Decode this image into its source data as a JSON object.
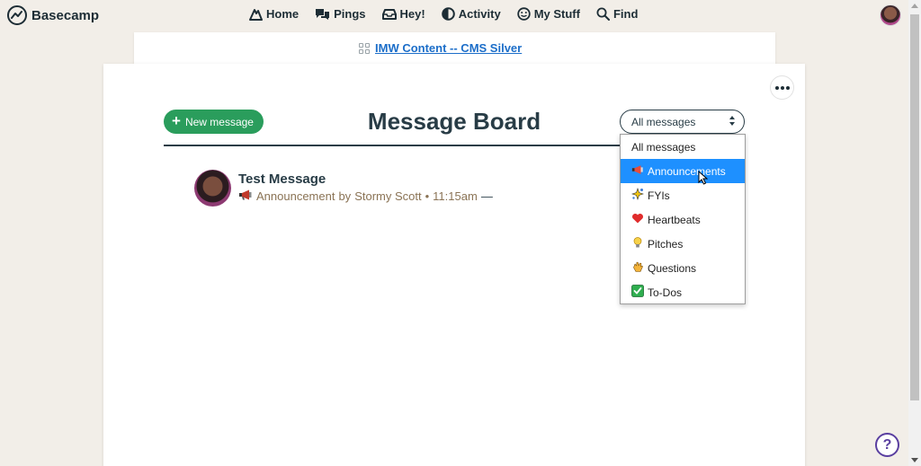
{
  "app": {
    "name": "Basecamp"
  },
  "nav": [
    {
      "label": "Home",
      "icon": "home-icon"
    },
    {
      "label": "Pings",
      "icon": "pings-icon"
    },
    {
      "label": "Hey!",
      "icon": "inbox-icon"
    },
    {
      "label": "Activity",
      "icon": "activity-icon"
    },
    {
      "label": "My Stuff",
      "icon": "smiley-icon"
    },
    {
      "label": "Find",
      "icon": "search-icon"
    }
  ],
  "project": {
    "name": "IMW Content -- CMS Silver"
  },
  "board": {
    "title": "Message Board",
    "new_message_label": "New message",
    "filter_selected": "All messages"
  },
  "message": {
    "title": "Test Message",
    "category": "Announcement",
    "by_text": "by",
    "author": "Stormy Scott",
    "separator": "•",
    "time": "11:15am",
    "dash": "—"
  },
  "filter_options": [
    {
      "label": "All messages",
      "icon": ""
    },
    {
      "label": "Announcements",
      "icon": "megaphone-icon"
    },
    {
      "label": "FYIs",
      "icon": "sparkle-icon"
    },
    {
      "label": "Heartbeats",
      "icon": "heart-icon"
    },
    {
      "label": "Pitches",
      "icon": "lightbulb-icon"
    },
    {
      "label": "Questions",
      "icon": "raised-hand-icon"
    },
    {
      "label": "To-Dos",
      "icon": "checkmark-icon"
    }
  ],
  "help": {
    "label": "?"
  },
  "colors": {
    "background": "#f2eee8",
    "primary_green": "#2a9d5c",
    "link_blue": "#1c6ec9",
    "dropdown_highlight": "#1e90ff",
    "meta_brown": "#8a7355",
    "help_purple": "#5a3fa0"
  }
}
